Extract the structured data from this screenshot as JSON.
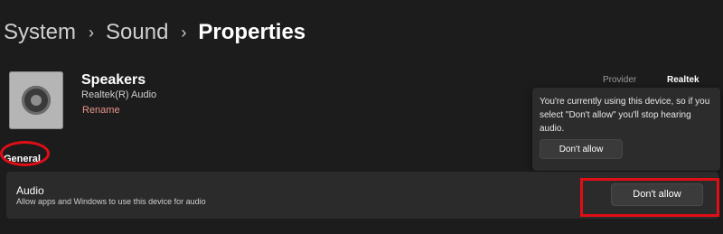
{
  "breadcrumb": {
    "items": [
      "System",
      "Sound",
      "Properties"
    ],
    "separator": "›"
  },
  "device": {
    "name": "Speakers",
    "driver": "Realtek(R) Audio",
    "rename_label": "Rename",
    "icon": "speaker-icon"
  },
  "provider": {
    "label": "Provider",
    "value": "Realtek"
  },
  "flyout": {
    "message": "You're currently using this device, so if you select \"Don't allow\" you'll stop hearing audio.",
    "button_label": "Don't allow"
  },
  "general": {
    "heading": "General"
  },
  "audio": {
    "title": "Audio",
    "description": "Allow apps and Windows to use this device for audio",
    "button_label": "Don't allow"
  },
  "colors": {
    "background": "#1c1c1c",
    "card": "#2b2b2b",
    "link": "#e8968a",
    "annotation": "#e10e16"
  }
}
